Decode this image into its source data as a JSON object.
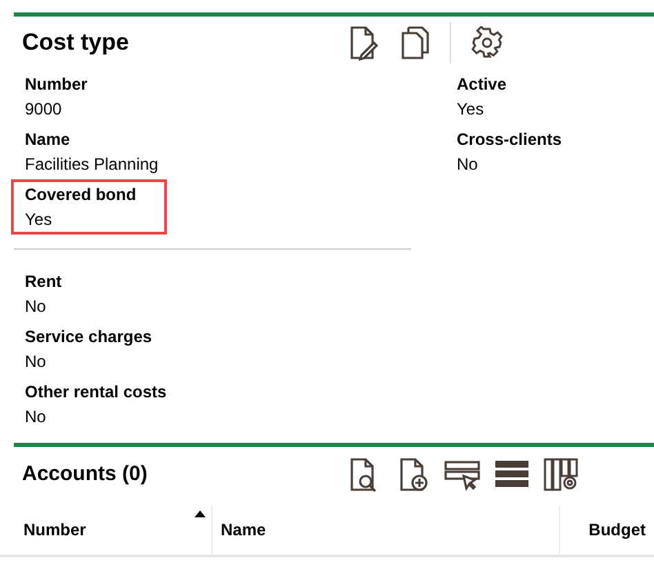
{
  "header": {
    "title": "Cost type"
  },
  "details": {
    "left": [
      {
        "label": "Number",
        "value": "9000",
        "highlighted": false
      },
      {
        "label": "Name",
        "value": "Facilities Planning",
        "highlighted": false
      },
      {
        "label": "Covered bond",
        "value": "Yes",
        "highlighted": true
      }
    ],
    "right": [
      {
        "label": "Active",
        "value": "Yes"
      },
      {
        "label": "Cross-clients",
        "value": "No"
      }
    ]
  },
  "rental": [
    {
      "label": "Rent",
      "value": "No"
    },
    {
      "label": "Service charges",
      "value": "No"
    },
    {
      "label": "Other rental costs",
      "value": "No"
    }
  ],
  "accounts": {
    "title": "Accounts (0)",
    "columns": [
      {
        "label": "Number",
        "sorted": true
      },
      {
        "label": "Name",
        "sorted": false
      },
      {
        "label": "Budget",
        "sorted": false
      }
    ]
  }
}
